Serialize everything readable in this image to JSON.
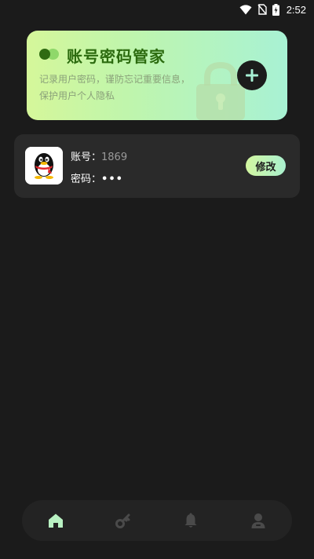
{
  "status_bar": {
    "time": "2:52",
    "icons": [
      "wifi-icon",
      "no-sim-icon",
      "battery-charging-icon"
    ]
  },
  "header": {
    "title": "账号密码管家",
    "description": "记录用户密码，谨防忘记重要信息，保护用户个人隐私",
    "add_label": "+",
    "colors": {
      "gradient_start": "#d5f79a",
      "gradient_end": "#a8f2d4",
      "title": "#2c6b0f"
    }
  },
  "accounts": [
    {
      "icon": "qq-penguin-icon",
      "username_label": "账号：",
      "username": "1869",
      "password_label": "密码：",
      "password": "•••",
      "edit_label": "修改"
    }
  ],
  "bottom_nav": {
    "items": [
      {
        "icon": "home-icon",
        "active": true
      },
      {
        "icon": "key-icon",
        "active": false
      },
      {
        "icon": "bell-icon",
        "active": false
      },
      {
        "icon": "user-icon",
        "active": false
      }
    ],
    "colors": {
      "active": "#b8f1c2",
      "inactive": "#4a4a4a"
    }
  }
}
